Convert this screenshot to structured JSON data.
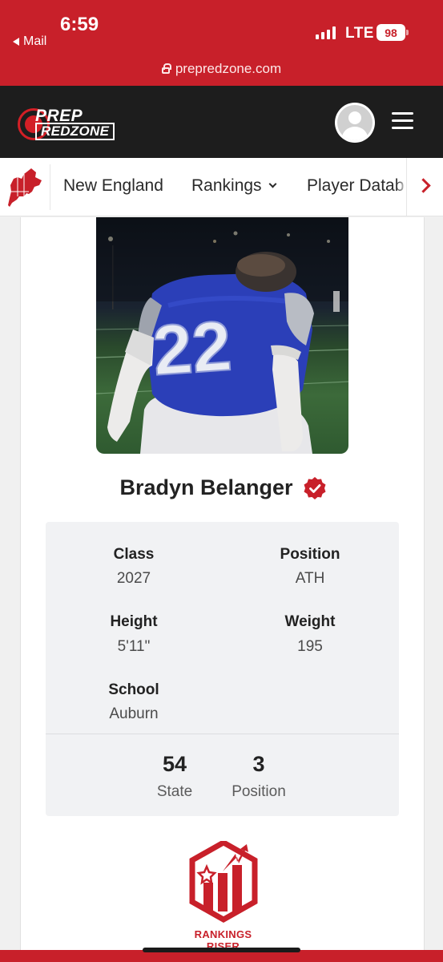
{
  "status_bar": {
    "time": "6:59",
    "back_label": "Mail",
    "network": "LTE",
    "battery": "98"
  },
  "browser": {
    "url": "prepredzone.com"
  },
  "header": {
    "logo_top": "PREP",
    "logo_bottom": "REDZONE"
  },
  "subnav": {
    "items": [
      {
        "label": "New England"
      },
      {
        "label": "Rankings"
      },
      {
        "label": "Player Datab"
      }
    ]
  },
  "player": {
    "name": "Bradyn Belanger",
    "jersey_number": "22",
    "details": {
      "class_label": "Class",
      "class_value": "2027",
      "position_label": "Position",
      "position_value": "ATH",
      "height_label": "Height",
      "height_value": "5'11\"",
      "weight_label": "Weight",
      "weight_value": "195",
      "school_label": "School",
      "school_value": "Auburn"
    },
    "rankings": {
      "state_rank": "54",
      "state_label": "State",
      "position_rank": "3",
      "position_label": "Position"
    }
  },
  "badge": {
    "line1": "RANKINGS",
    "line2": "RISER"
  },
  "colors": {
    "brand_red": "#c8202a",
    "header_dark": "#1d1d1d",
    "jersey_blue": "#2b3fb8"
  },
  "icons": [
    "back-arrow-icon",
    "signal-icon",
    "battery-icon",
    "lock-icon",
    "region-map-icon",
    "avatar-icon",
    "menu-icon",
    "chevron-down-icon",
    "chevron-right-icon",
    "verified-icon",
    "rankings-riser-icon"
  ]
}
